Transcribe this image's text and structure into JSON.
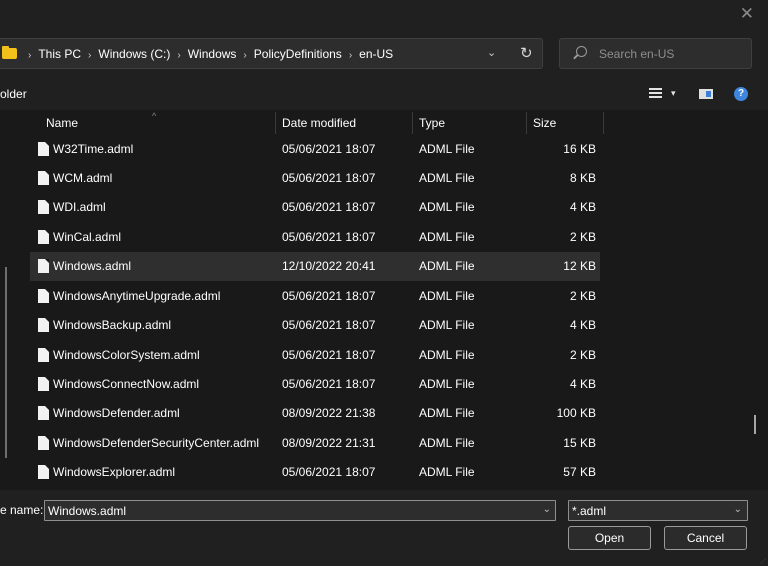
{
  "window": {
    "close_glyph": "✕"
  },
  "address_bar": {
    "crumbs": [
      "This PC",
      "Windows (C:)",
      "Windows",
      "PolicyDefinitions",
      "en-US"
    ],
    "separator": "›",
    "dropdown_glyph": "⌄",
    "refresh_glyph": "↻"
  },
  "search": {
    "placeholder": "Search en-US"
  },
  "toolbar": {
    "folder_label": "older",
    "view_dropdown_glyph": "▾",
    "help_glyph": "?"
  },
  "columns": {
    "name": "Name",
    "date": "Date modified",
    "type": "Type",
    "size": "Size",
    "sort_glyph": "^"
  },
  "files": [
    {
      "name": "W32Time.adml",
      "date": "05/06/2021 18:07",
      "type": "ADML File",
      "size": "16 KB"
    },
    {
      "name": "WCM.adml",
      "date": "05/06/2021 18:07",
      "type": "ADML File",
      "size": "8 KB"
    },
    {
      "name": "WDI.adml",
      "date": "05/06/2021 18:07",
      "type": "ADML File",
      "size": "4 KB"
    },
    {
      "name": "WinCal.adml",
      "date": "05/06/2021 18:07",
      "type": "ADML File",
      "size": "2 KB"
    },
    {
      "name": "Windows.adml",
      "date": "12/10/2022 20:41",
      "type": "ADML File",
      "size": "12 KB"
    },
    {
      "name": "WindowsAnytimeUpgrade.adml",
      "date": "05/06/2021 18:07",
      "type": "ADML File",
      "size": "2 KB"
    },
    {
      "name": "WindowsBackup.adml",
      "date": "05/06/2021 18:07",
      "type": "ADML File",
      "size": "4 KB"
    },
    {
      "name": "WindowsColorSystem.adml",
      "date": "05/06/2021 18:07",
      "type": "ADML File",
      "size": "2 KB"
    },
    {
      "name": "WindowsConnectNow.adml",
      "date": "05/06/2021 18:07",
      "type": "ADML File",
      "size": "4 KB"
    },
    {
      "name": "WindowsDefender.adml",
      "date": "08/09/2022 21:38",
      "type": "ADML File",
      "size": "100 KB"
    },
    {
      "name": "WindowsDefenderSecurityCenter.adml",
      "date": "08/09/2022 21:31",
      "type": "ADML File",
      "size": "15 KB"
    },
    {
      "name": "WindowsExplorer.adml",
      "date": "05/06/2021 18:07",
      "type": "ADML File",
      "size": "57 KB"
    }
  ],
  "selected_file": "Windows.adml",
  "footer": {
    "file_name_label": "e name:",
    "file_name_value": "Windows.adml",
    "file_type_value": "*.adml",
    "dropdown_glyph": "⌄",
    "open_label": "Open",
    "cancel_label": "Cancel"
  },
  "colors": {
    "background": "#191919",
    "chrome": "#202020",
    "selected_row": "#2f2f2f",
    "folder": "#f3c21a",
    "accent": "#3e86dd"
  }
}
